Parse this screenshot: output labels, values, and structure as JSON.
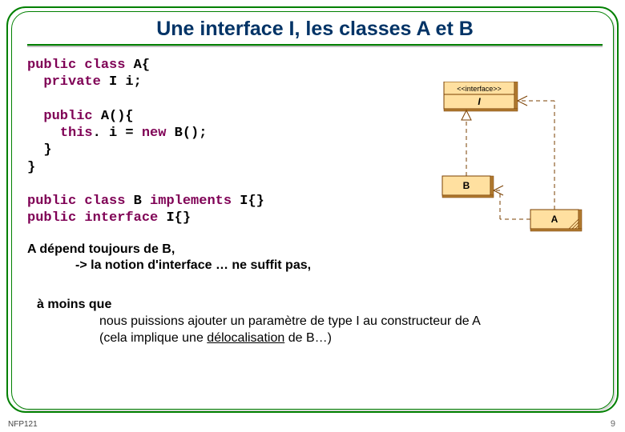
{
  "title": "Une interface I, les classes A et B",
  "code": {
    "l1a": "public",
    "l1b": " ",
    "l1c": "class",
    "l1d": " A{",
    "l2a": "  ",
    "l2b": "private",
    "l2c": " I i;",
    "l3": "",
    "l4a": "  ",
    "l4b": "public",
    "l4c": " A(){",
    "l5a": "    ",
    "l5b": "this",
    "l5c": ". i = ",
    "l5d": "new",
    "l5e": " B();",
    "l6": "  }",
    "l7": "}",
    "l8": "",
    "l9a": "public",
    "l9b": " ",
    "l9c": "class",
    "l9d": " B ",
    "l9e": "implements",
    "l9f": " I{}",
    "l10a": "public",
    "l10b": " ",
    "l10c": "interface",
    "l10d": " I{}"
  },
  "text": {
    "p1a": "A dépend toujours de B,",
    "p1b": "-> la notion d'interface … ne suffit pas,",
    "p2a": "à moins que",
    "p2b": "nous puissions ajouter un paramètre de type I au constructeur de A",
    "p2c_prefix": "(cela implique une ",
    "p2c_under": "délocalisation",
    "p2c_suffix": " de B…)"
  },
  "uml": {
    "stereotype": "<<interface>>",
    "I": "I",
    "B": "B",
    "A": "A"
  },
  "footer": {
    "left": "NFP121",
    "right": "9"
  }
}
